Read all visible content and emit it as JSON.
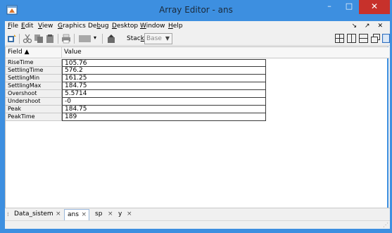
{
  "window": {
    "title": "Array Editor - ans"
  },
  "window_controls": {
    "minimize": "–",
    "maximize": "□",
    "close": "✕"
  },
  "menu": {
    "items": [
      {
        "pre": "",
        "u": "F",
        "post": "ile"
      },
      {
        "pre": "",
        "u": "E",
        "post": "dit"
      },
      {
        "pre": "",
        "u": "V",
        "post": "iew"
      },
      {
        "pre": "",
        "u": "G",
        "post": "raphics"
      },
      {
        "pre": "De",
        "u": "b",
        "post": "ug"
      },
      {
        "pre": "",
        "u": "D",
        "post": "esktop"
      },
      {
        "pre": "",
        "u": "W",
        "post": "indow"
      },
      {
        "pre": "",
        "u": "H",
        "post": "elp"
      }
    ],
    "dock_controls": "↘ ↗ ✕"
  },
  "toolbar": {
    "stack_label_pre": "Stac",
    "stack_label_u": "k",
    "stack_label_post": ":",
    "stack_value": "Base"
  },
  "table": {
    "columns": [
      "Field ▲",
      "Value"
    ],
    "rows": [
      {
        "field": "RiseTime",
        "value": "105.76"
      },
      {
        "field": "SettlingTime",
        "value": "576.2"
      },
      {
        "field": "SettlingMin",
        "value": "161.25"
      },
      {
        "field": "SettlingMax",
        "value": "184.75"
      },
      {
        "field": "Overshoot",
        "value": "5.5714"
      },
      {
        "field": "Undershoot",
        "value": "-0"
      },
      {
        "field": "Peak",
        "value": "184.75"
      },
      {
        "field": "PeakTime",
        "value": "189"
      }
    ]
  },
  "tabs": [
    {
      "label": "Data_sistem",
      "active": false
    },
    {
      "label": "ans",
      "active": true
    },
    {
      "label": "sp",
      "active": false
    },
    {
      "label": "y",
      "active": false
    }
  ],
  "tab_close_glyph": "×",
  "colors": {
    "titlebar": "#3d8fe0",
    "close_button": "#c7312b"
  }
}
